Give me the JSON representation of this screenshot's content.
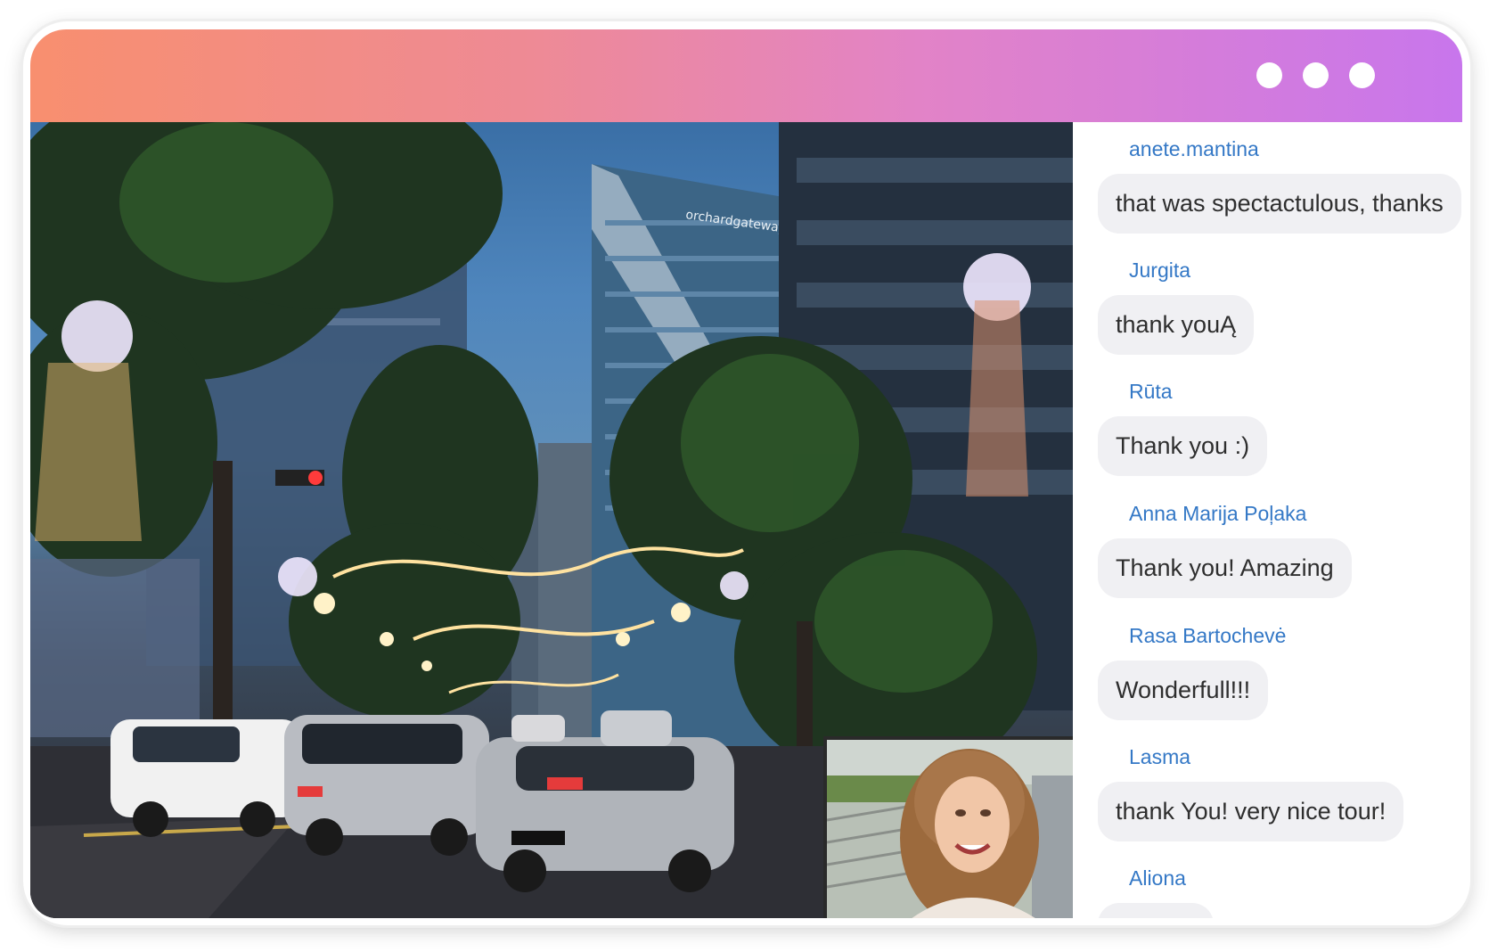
{
  "window": {
    "controls": [
      "dot",
      "dot",
      "dot"
    ],
    "accent_gradient": [
      "#f88f6f",
      "#ee8a95",
      "#e283c7",
      "#c876ec"
    ]
  },
  "video": {
    "sign_text": "orchardgateway",
    "presenter_thumbnail": "presenter-camera"
  },
  "chat": {
    "sender_color": "#3478c6",
    "messages": [
      {
        "sender": "anete.mantina",
        "text": "that was spectactulous, thanks"
      },
      {
        "sender": "Jurgita",
        "text": "thank youĄ"
      },
      {
        "sender": "Rūta",
        "text": "Thank you :)"
      },
      {
        "sender": "Anna Marija Poļaka",
        "text": "Thank you! Amazing"
      },
      {
        "sender": "Rasa Bartochevė",
        "text": "Wonderfull!!!"
      },
      {
        "sender": "Lasma",
        "text": "thank You! very nice tour!"
      },
      {
        "sender": "Aliona",
        "text": ""
      }
    ]
  }
}
